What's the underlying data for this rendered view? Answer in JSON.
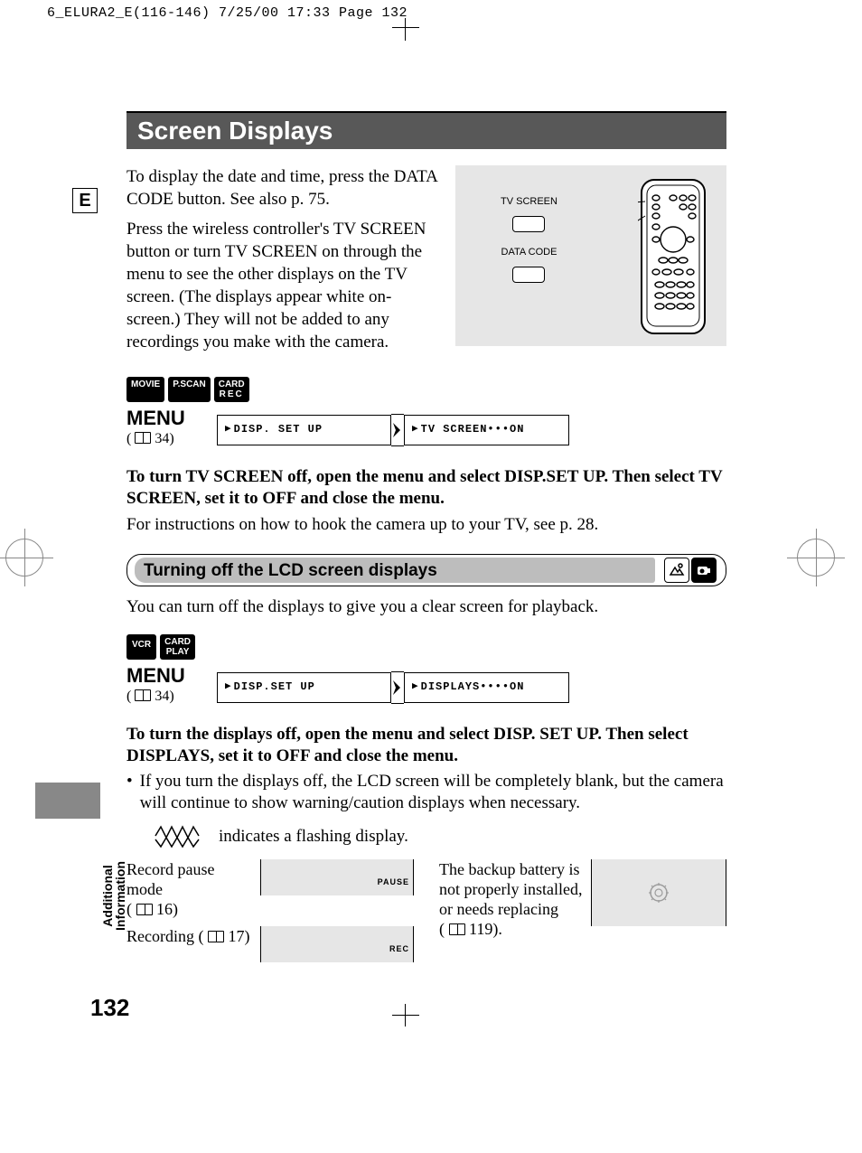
{
  "print_header": "6_ELURA2_E(116-146)  7/25/00 17:33  Page 132",
  "side_tab": "E",
  "title": "Screen Displays",
  "intro_p1": "To display the date and time, press the DATA CODE button. See also p. 75.",
  "intro_p2": "Press the wireless controller's TV SCREEN button or turn TV SCREEN on through the menu to see the other displays on the TV screen. (The displays appear white on-screen.) They will not be added to any recordings you make with the camera.",
  "remote": {
    "lbl1": "TV SCREEN",
    "lbl2": "DATA CODE"
  },
  "badges1": {
    "a": "MOVIE",
    "b": "P.SCAN",
    "c_line1": "CARD",
    "c_line2": "REC"
  },
  "menu_label": "MENU",
  "menu_ref": "34",
  "menu1_box1": "DISP. SET UP",
  "menu1_box2": "TV SCREEN•••ON",
  "bold1": "To turn TV SCREEN off, open the menu and select DISP.SET UP. Then select TV SCREEN, set it to OFF and close the menu.",
  "after_bold1": "For instructions on how to hook the camera up to your TV, see p. 28.",
  "subheader": "Turning off the LCD screen displays",
  "after_sub": "You can turn off the displays to give you a clear screen for playback.",
  "badges2": {
    "a": "VCR",
    "b_line1": "CARD",
    "b_line2": "PLAY"
  },
  "menu2_box1": "DISP.SET UP",
  "menu2_box2": "DISPLAYS••••ON",
  "bold2": "To turn the displays off, open the menu and select DISP. SET UP. Then select DISPLAYS, set it to OFF and close the menu.",
  "bullet": "If you turn the displays off, the LCD screen will be completely blank, but the camera will continue to show warning/caution displays when necessary.",
  "flash_note": "indicates a flashing display.",
  "disp_table": {
    "left": [
      {
        "caption": "Record pause mode",
        "ref": "16",
        "box": "PAUSE"
      },
      {
        "caption": "Recording",
        "ref": "17",
        "box": "REC"
      }
    ],
    "right": [
      {
        "caption": "The backup battery is not properly installed, or needs replacing",
        "ref": "119"
      }
    ]
  },
  "section_label_1": "Additional",
  "section_label_2": "Information",
  "page_number": "132"
}
